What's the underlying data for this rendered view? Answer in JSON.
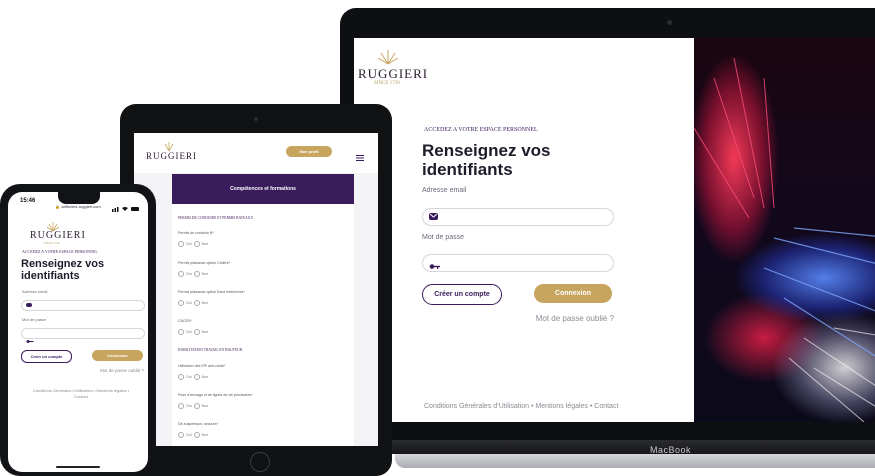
{
  "brand": {
    "name": "RUGGIERI",
    "since": "SINCE 1739"
  },
  "laptop": {
    "eyebrow": "ACCEDEZ A VOTRE ESPACE PERSONNEL",
    "title_line1": "Renseignez vos",
    "title_line2": "identifiants",
    "email_label": "Adresse email",
    "password_label": "Mot de passe",
    "create_account": "Créer un compte",
    "connect": "Connexion",
    "forgot": "Mot de passe oublié ?",
    "footer": "Conditions Générales d’Utilisation • Mentions légales • Contact",
    "device_label": "MacBook"
  },
  "tablet": {
    "profile_button": "Mon profil",
    "section_title": "Compétences et formations",
    "group1_title": "PERMIS DE CONDUIRE ET PERMIS BATEAUX",
    "questions1": [
      {
        "label": "Permis de conduire B*"
      },
      {
        "label": "Permis plaisance option Côtière*"
      },
      {
        "label": "Permis plaisance option Eaux Intérieures*"
      },
      {
        "label": "CACES*"
      }
    ],
    "group2_title": "HABILITATION TRAVAIL EN HAUTEUR",
    "questions2": [
      {
        "label": "Utilisation des EPI anti-chute*"
      },
      {
        "label": "Pose d’ancrage et de lignes de vie provisoires*"
      },
      {
        "label": "Dé-suspension, secours*"
      }
    ],
    "yes": "Oui",
    "no": "Non"
  },
  "phone": {
    "time": "15:46",
    "url": "artificiers-ruggieri.com",
    "eyebrow": "ACCEDEZ A VOTRE ESPACE PERSONNEL",
    "title_line1": "Renseignez vos",
    "title_line2": "identifiants",
    "email_label": "Adresse email",
    "password_label": "Mot de passe",
    "create_account": "Créer un compte",
    "connect": "Connexion",
    "forgot": "Mot de passe oublié ?",
    "footer": "Conditions Générales d’Utilisation • Mentions légales • Contact"
  },
  "colors": {
    "accent_purple": "#3a1b5c",
    "accent_gold": "#c8a55f"
  }
}
